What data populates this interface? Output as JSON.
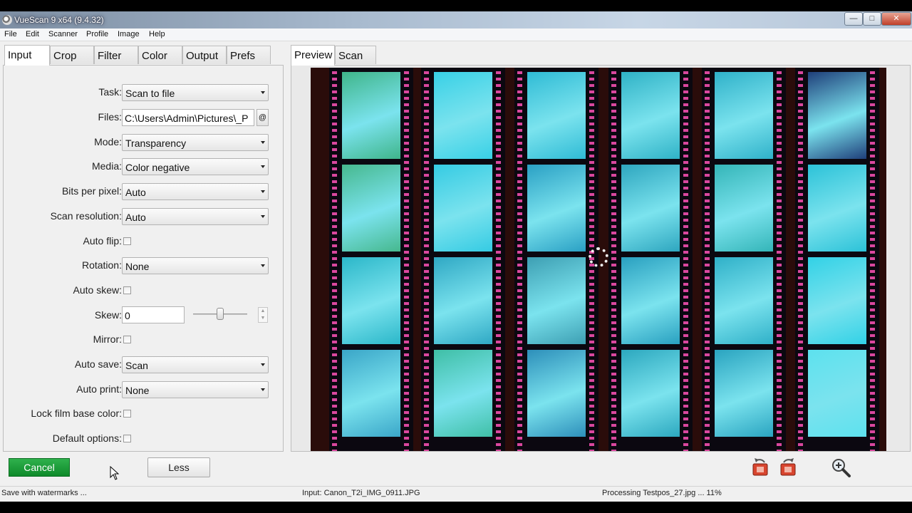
{
  "window": {
    "title": "VueScan 9 x64 (9.4.32)",
    "controls": [
      "—",
      "□",
      "✕"
    ]
  },
  "menu": [
    "File",
    "Edit",
    "Scanner",
    "Profile",
    "Image",
    "Help"
  ],
  "left_tabs": [
    "Input",
    "Crop",
    "Filter",
    "Color",
    "Output",
    "Prefs"
  ],
  "right_tabs": [
    "Preview",
    "Scan"
  ],
  "input": {
    "task": {
      "label": "Task:",
      "value": "Scan to file"
    },
    "files": {
      "label": "Files:",
      "value": "C:\\Users\\Admin\\Pictures\\_P",
      "browse": "@"
    },
    "mode": {
      "label": "Mode:",
      "value": "Transparency"
    },
    "media": {
      "label": "Media:",
      "value": "Color negative"
    },
    "bits": {
      "label": "Bits per pixel:",
      "value": "Auto"
    },
    "resolution": {
      "label": "Scan resolution:",
      "value": "Auto"
    },
    "auto_flip": {
      "label": "Auto flip:"
    },
    "rotation": {
      "label": "Rotation:",
      "value": "None"
    },
    "auto_skew": {
      "label": "Auto skew:"
    },
    "skew": {
      "label": "Skew:",
      "value": "0"
    },
    "mirror": {
      "label": "Mirror:"
    },
    "auto_save": {
      "label": "Auto save:",
      "value": "Scan"
    },
    "auto_print": {
      "label": "Auto print:",
      "value": "None"
    },
    "lock_film": {
      "label": "Lock film base color:"
    },
    "default_options": {
      "label": "Default options:"
    }
  },
  "buttons": {
    "cancel": "Cancel",
    "less": "Less"
  },
  "status": {
    "left": "Save with watermarks ...",
    "middle": "Input: Canon_T2i_IMG_0911.JPG",
    "right": "Processing Testpos_27.jpg ... 11%"
  },
  "colors": {
    "cancel_green": "#16962f",
    "film_base": "#2a0c0a",
    "sprocket": "#d9479e",
    "frame_cyan": "#29c7d8"
  }
}
